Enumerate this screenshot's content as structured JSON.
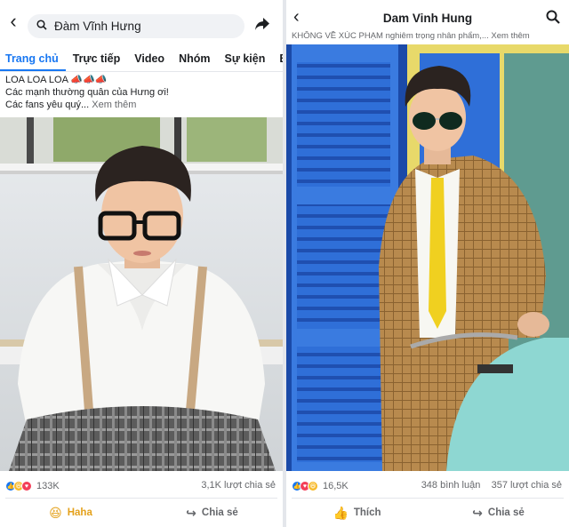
{
  "left": {
    "search_value": "Đàm Vĩnh Hưng",
    "tabs": [
      "Trang chủ",
      "Trực tiếp",
      "Video",
      "Nhóm",
      "Sự kiện",
      "Bài"
    ],
    "post_line1": "LOA LOA LOA 📣📣📣",
    "post_line2": "Các mạnh thường quân của Hưng ơi!",
    "post_line3": "Các fans yêu quý...",
    "see_more": "Xem thêm",
    "reaction_count": "133K",
    "share_count": "3,1K lượt chia sẻ",
    "action_react": "Haha",
    "action_share": "Chia sẻ"
  },
  "right": {
    "title": "Dam Vinh Hung",
    "cut_text": "KHÔNG VỀ XÚC PHẠM nghiêm trọng nhân phẩm,... Xem thêm",
    "reaction_count": "16,5K",
    "comment_count": "348 bình luận",
    "share_count": "357 lượt chia sẻ",
    "action_like": "Thích",
    "action_share": "Chia sẻ"
  },
  "icons": {
    "back": "back-chevron-icon",
    "search": "search-icon",
    "share": "share-arrow-icon",
    "like": "like-icon",
    "haha": "haha-icon",
    "love": "love-icon"
  },
  "colors": {
    "accent": "#1877f2",
    "haha": "#f7b928",
    "love": "#f33e58",
    "muted": "#65676b"
  }
}
